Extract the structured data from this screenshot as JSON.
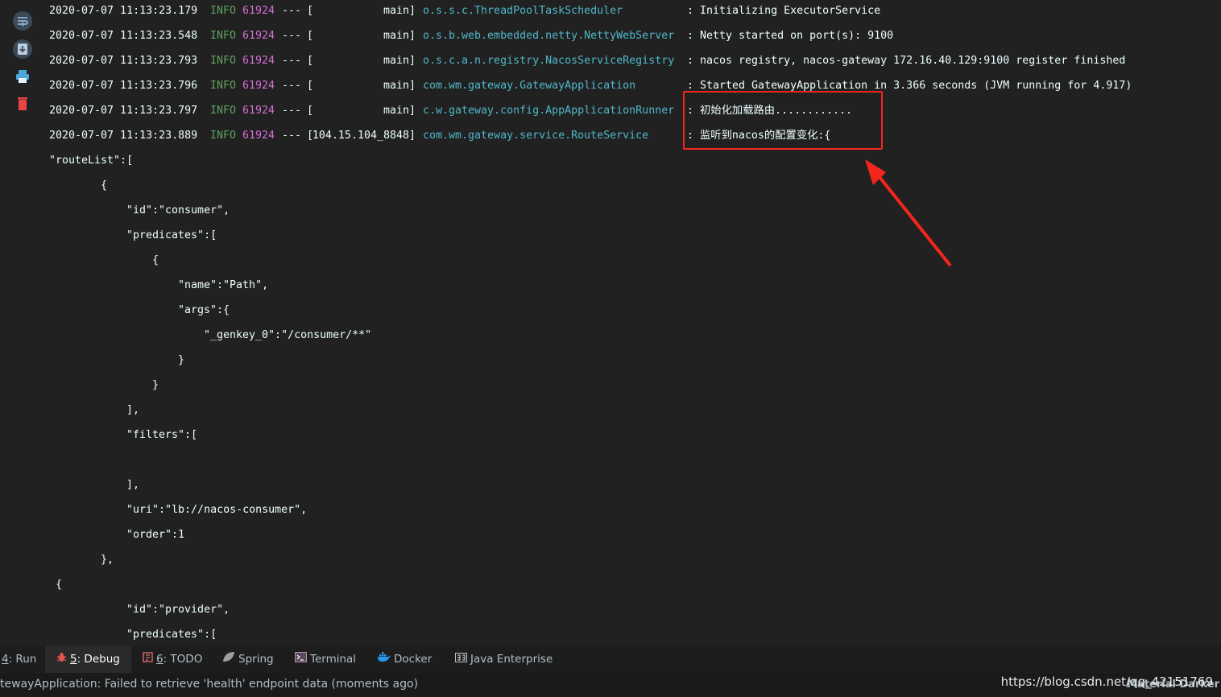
{
  "gutter": {
    "icons": [
      "soft-wrap-icon",
      "scroll-to-end-icon",
      "print-icon",
      "clear-all-icon"
    ]
  },
  "log_lines": [
    {
      "ts": "2020-07-07 11:13:23.179",
      "level": "INFO",
      "pid": "61924",
      "sep": "---",
      "thread": "main]",
      "logger": "o.s.s.c.ThreadPoolTaskScheduler",
      "message": ": Initializing ExecutorService"
    },
    {
      "ts": "2020-07-07 11:13:23.548",
      "level": "INFO",
      "pid": "61924",
      "sep": "---",
      "thread": "main]",
      "logger": "o.s.b.web.embedded.netty.NettyWebServer",
      "message": ": Netty started on port(s): 9100"
    },
    {
      "ts": "2020-07-07 11:13:23.793",
      "level": "INFO",
      "pid": "61924",
      "sep": "---",
      "thread": "main]",
      "logger": "o.s.c.a.n.registry.NacosServiceRegistry",
      "message": ": nacos registry, nacos-gateway 172.16.40.129:9100 register finished"
    },
    {
      "ts": "2020-07-07 11:13:23.796",
      "level": "INFO",
      "pid": "61924",
      "sep": "---",
      "thread": "main]",
      "logger": "com.wm.gateway.GatewayApplication",
      "message": ": Started GatewayApplication in 3.366 seconds (JVM running for 4.917)"
    },
    {
      "ts": "2020-07-07 11:13:23.797",
      "level": "INFO",
      "pid": "61924",
      "sep": "---",
      "thread": "main]",
      "logger": "c.w.gateway.config.AppApplicationRunner",
      "message": ": 初始化加载路由............"
    },
    {
      "ts": "2020-07-07 11:13:23.889",
      "level": "INFO",
      "pid": "61924",
      "sep": "---",
      "thread": "104.15.104_8848]",
      "logger": "com.wm.gateway.service.RouteService",
      "message": ": 监听到nacos的配置变化:{"
    }
  ],
  "thread_open": "[",
  "json_lines": [
    "\"routeList\":[",
    "{",
    "\"id\":\"consumer\",",
    "\"predicates\":[",
    "{",
    "\"name\":\"Path\",",
    "\"args\":{",
    "\"_genkey_0\":\"/consumer/**\"",
    "}",
    "}",
    "],",
    "\"filters\":[",
    "",
    "],",
    "\"uri\":\"lb://nacos-consumer\",",
    "\"order\":1",
    "},",
    "{",
    "\"id\":\"provider\",",
    "\"predicates\":["
  ],
  "toolbar": {
    "tabs": [
      {
        "num": "4",
        "label": ": Run"
      },
      {
        "num": "5",
        "label": ": Debug"
      },
      {
        "num": "6",
        "label": ": TODO"
      },
      {
        "num": "",
        "label": "Spring"
      },
      {
        "num": "",
        "label": "Terminal"
      },
      {
        "num": "",
        "label": "Docker"
      },
      {
        "num": "",
        "label": "Java Enterprise"
      }
    ]
  },
  "status": {
    "text": "tewayApplication: Failed to retrieve 'health' endpoint data (moments ago)",
    "theme": "Material Darker",
    "watermark": "https://blog.csdn.net/qq_42151769"
  }
}
